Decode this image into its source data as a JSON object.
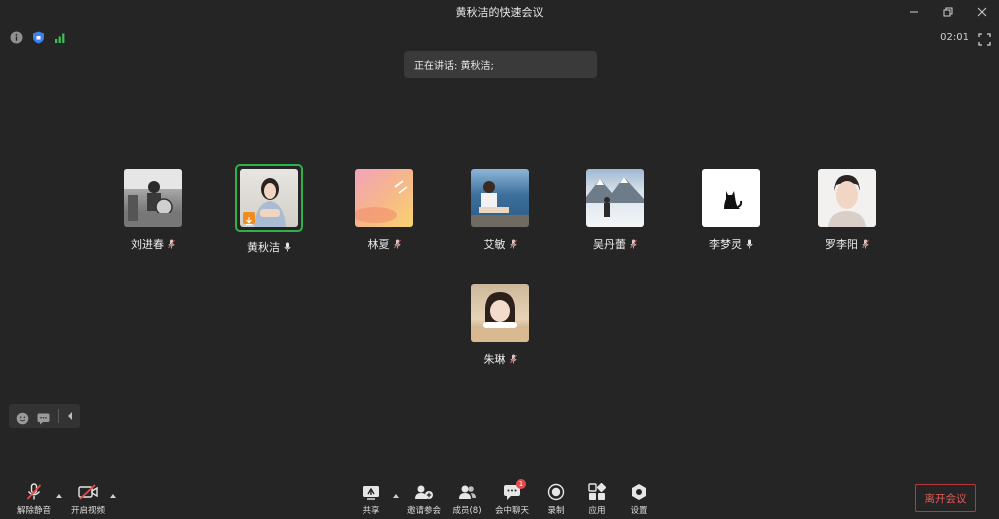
{
  "window": {
    "title": "黄秋洁的快速会议"
  },
  "status": {
    "timer": "02:01",
    "icons": [
      "info-icon",
      "shield-icon",
      "signal-icon"
    ]
  },
  "speaking": {
    "text": "正在讲话: 黄秋洁;"
  },
  "participants": [
    {
      "name": "刘进春",
      "mic": "muted",
      "active": false
    },
    {
      "name": "黄秋洁",
      "mic": "on",
      "active": true
    },
    {
      "name": "林夏",
      "mic": "muted",
      "active": false
    },
    {
      "name": "艾敏",
      "mic": "muted",
      "active": false
    },
    {
      "name": "吴丹蕾",
      "mic": "muted",
      "active": false
    },
    {
      "name": "李梦灵",
      "mic": "on",
      "active": false
    },
    {
      "name": "罗李阳",
      "mic": "muted",
      "active": false
    },
    {
      "name": "朱琳",
      "mic": "muted",
      "active": false
    }
  ],
  "toolbar": {
    "unmute_label": "解除静音",
    "video_label": "开启视频",
    "share_label": "共享",
    "invite_label": "邀请参会",
    "members_label": "成员(8)",
    "chat_label": "会中聊天",
    "chat_badge": "1",
    "record_label": "录制",
    "apps_label": "应用",
    "settings_label": "设置",
    "leave_label": "离开会议"
  },
  "colors": {
    "background": "#252525",
    "active_border": "#2fb14a",
    "leave": "#e45a5c",
    "shield": "#3d7ff2",
    "signal": "#3cc25a"
  }
}
